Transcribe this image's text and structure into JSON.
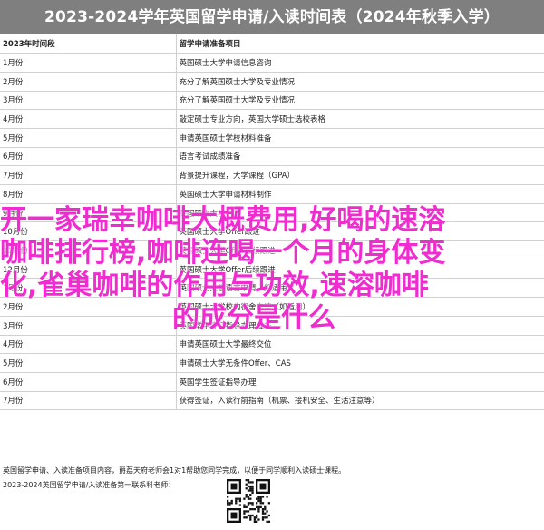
{
  "title": "2023-2024学年英国留学申请/入读时间表（2024年秋季入学）",
  "table": {
    "headers": [
      "2023年时间段",
      "留学申请准备项目"
    ],
    "rows": [
      [
        "1月份",
        "英国硕士大学申请信息咨询"
      ],
      [
        "2月份",
        "充分了解英国硕士大学及专业情况"
      ],
      [
        "3月份",
        "充分了解英国硕士大学及专业情况"
      ],
      [
        "4月份",
        "敲定硕士专业方向，英国大学硕士选校表格"
      ],
      [
        "5月份",
        "申请英国硕士学校材料准备"
      ],
      [
        "6月份",
        "语言考试成绩准备"
      ],
      [
        "7月份",
        "背景提升课程，大学课程（GPA）"
      ],
      [
        "8月份",
        "英国硕士大学申请材料制作"
      ],
      [
        "9月份",
        "英国硕士大学申请"
      ],
      [
        "10月份",
        "英国硕士大学Offer跟进"
      ],
      [
        "11月份",
        "英国硕士大学Offer后续跟进"
      ],
      [
        "12月份",
        "英国硕士大学Offer后续跟进"
      ],
      [
        "1月份",
        "英国硕士大学语言申请（如适用）"
      ],
      [
        "2月份",
        "英国硕士大学校内宿舍申请（如适用）"
      ],
      [
        "3月份",
        "英国学生签证指导办理准备"
      ],
      [
        "4月份",
        "申请英国硕士大学最终交位"
      ],
      [
        "5月份",
        "申请硕士大学无条件Offer、CAS"
      ],
      [
        "6月份",
        "英国学生签证指导办理"
      ],
      [
        "7月份",
        "获得签证，入读行前指南（机票、接机安全、生活注意等）"
      ]
    ]
  },
  "footer": {
    "line1": "英国留学申请、入读准备项目内容，爵荔天府老师会1对1帮助您同学完成，以便于同学顺利入读硕士课程。",
    "line2": "2023-2024英国留学申请/入读准备第一联系科老师："
  },
  "overlay": {
    "line1": "开一家瑞幸咖啡大概费用,好喝的速溶",
    "line2": "咖啡排行榜,咖啡连喝一个月的身体变",
    "line3": "化,雀巢咖啡的作用与功效,速溶咖啡",
    "line4": "的成分是什么"
  },
  "colors": {
    "title_bg": "#7f7f7f",
    "overlay_text": "#f02bd0",
    "grid": "#d0d0d0"
  }
}
